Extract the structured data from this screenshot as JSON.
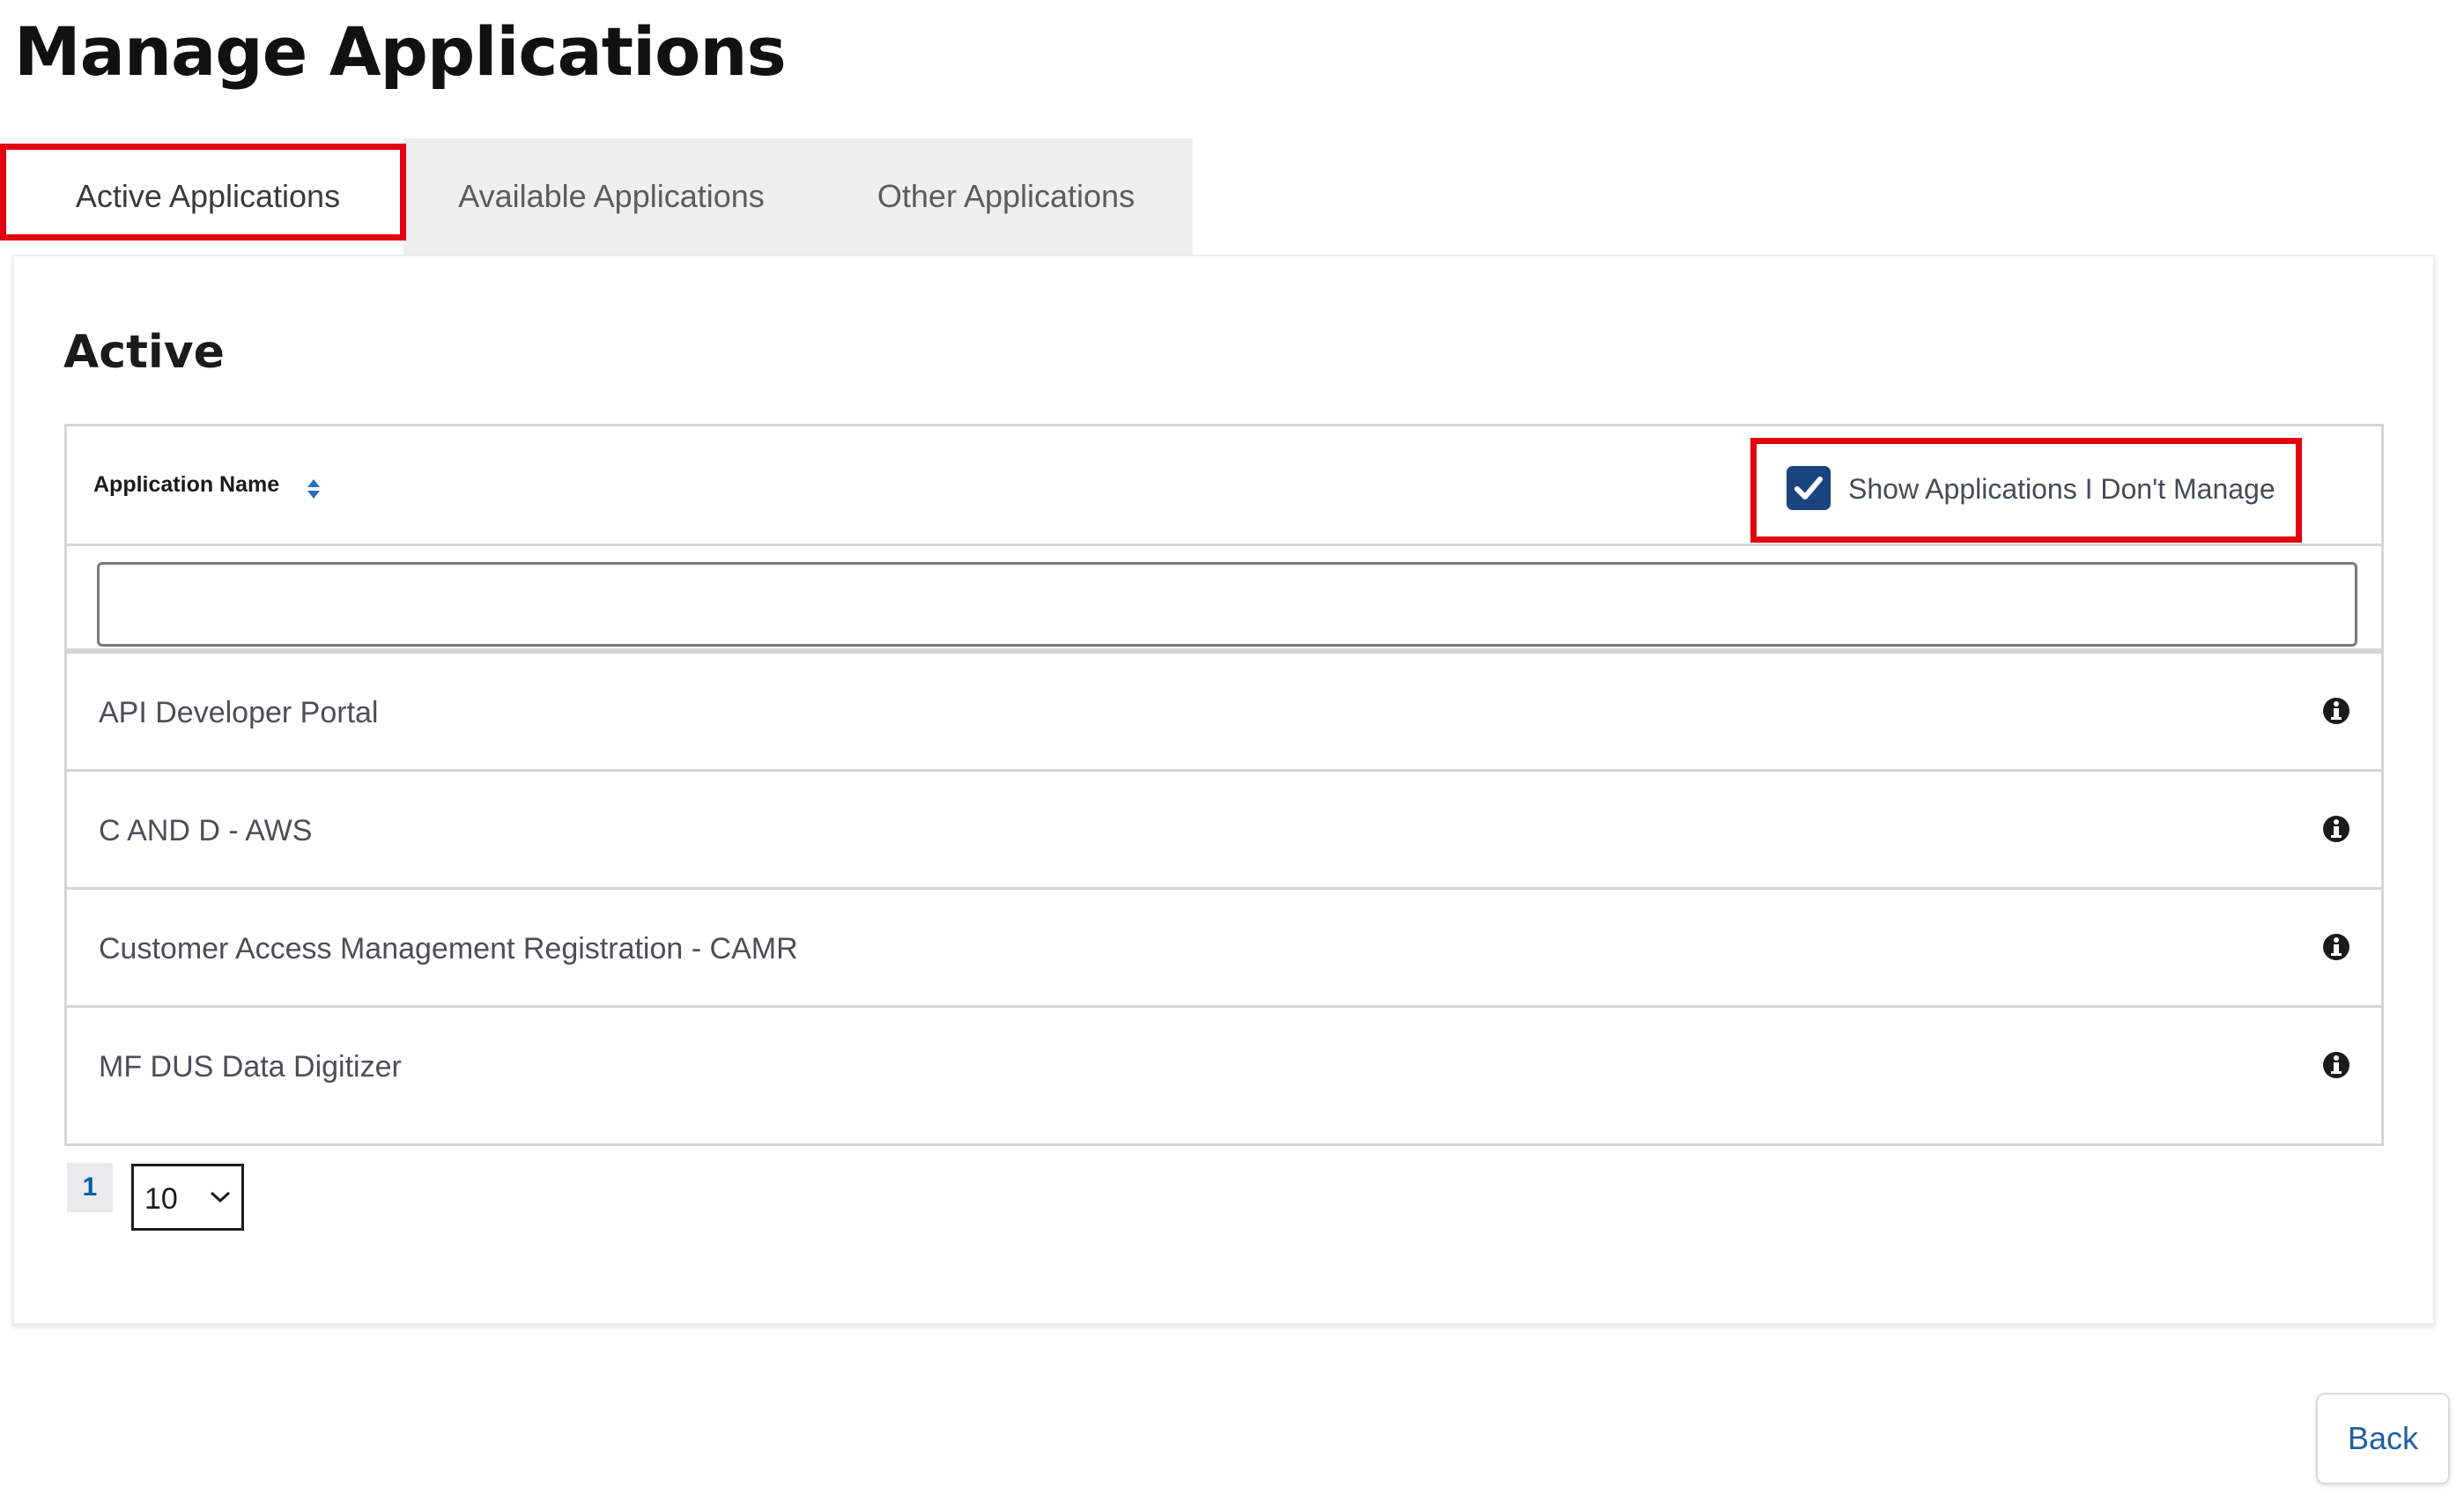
{
  "page": {
    "title": "Manage Applications"
  },
  "tabs": [
    {
      "label": "Active Applications",
      "active": true
    },
    {
      "label": "Available Applications",
      "active": false
    },
    {
      "label": "Other Applications",
      "active": false
    }
  ],
  "section": {
    "title": "Active"
  },
  "table": {
    "column_header": "Application Name",
    "show_unmanaged": {
      "label": "Show Applications I Don't Manage",
      "checked": true
    },
    "filter": {
      "value": "",
      "placeholder": ""
    },
    "rows": [
      {
        "name": "API Developer Portal",
        "icon": "info-icon"
      },
      {
        "name": "C AND D - AWS",
        "icon": "info-icon"
      },
      {
        "name": "Customer Access Management Registration - CAMR",
        "icon": "info-icon"
      },
      {
        "name": "MF DUS Data Digitizer",
        "icon": "info-icon"
      }
    ]
  },
  "pagination": {
    "current_page": "1",
    "page_size": "10"
  },
  "back_button": {
    "label": "Back"
  },
  "colors": {
    "highlight": "#e3000f",
    "checkbox": "#1a4480",
    "link": "#005ea2",
    "tab_bar": "#efefef"
  }
}
